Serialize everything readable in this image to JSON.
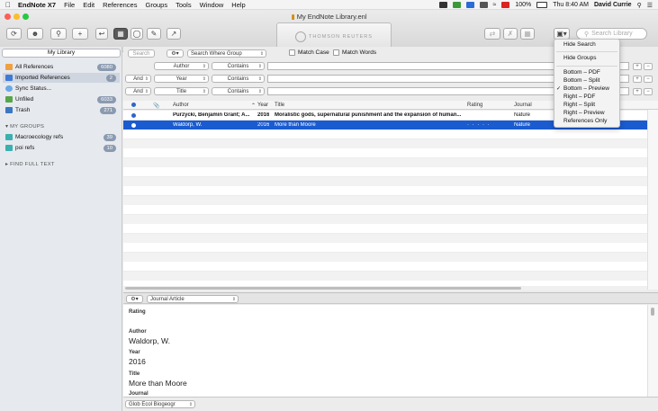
{
  "menubar": {
    "app": "EndNote X7",
    "items": [
      "File",
      "Edit",
      "References",
      "Groups",
      "Tools",
      "Window",
      "Help"
    ],
    "battery": "100%",
    "time": "Thu 8:40 AM",
    "user": "David Currie"
  },
  "window": {
    "title": "My EndNote Library.enl",
    "banner": "THOMSON REUTERS"
  },
  "search_library": {
    "placeholder": "Search Library"
  },
  "sidebar": {
    "library_select": "My Library",
    "items": [
      {
        "label": "All References",
        "count": "6080"
      },
      {
        "label": "Imported References",
        "count": "2"
      },
      {
        "label": "Sync Status...",
        "count": ""
      },
      {
        "label": "Unfiled",
        "count": "6033"
      },
      {
        "label": "Trash",
        "count": "271"
      }
    ],
    "groups_header": "MY GROUPS",
    "groups": [
      {
        "label": "Macroecology refs",
        "count": "39"
      },
      {
        "label": "poi refs",
        "count": "10"
      }
    ],
    "find_full_text": "FIND FULL TEXT"
  },
  "search_panel": {
    "search_button": "Search",
    "where": "Search Where Group",
    "match_case": "Match Case",
    "match_words": "Match Words",
    "rows": [
      {
        "bool": "",
        "field": "Author",
        "op": "Contains"
      },
      {
        "bool": "And",
        "field": "Year",
        "op": "Contains"
      },
      {
        "bool": "And",
        "field": "Title",
        "op": "Contains"
      }
    ]
  },
  "table": {
    "columns": [
      "Author",
      "Year",
      "Title",
      "Rating",
      "Journal"
    ],
    "rows": [
      {
        "author": "Purzycki, Benjamin Grant; A...",
        "year": "2016",
        "title": "Moralistic gods, supernatural punishment and the expansion of human...",
        "rating": "",
        "journal": "Nature"
      },
      {
        "author": "Waldorp, W.",
        "year": "2016",
        "title": "More than Moore",
        "rating": "· · · · ·",
        "journal": "Nature"
      }
    ]
  },
  "preview": {
    "ref_type": "Journal Article",
    "fields": [
      {
        "label": "Rating",
        "value": ""
      },
      {
        "label": "Author",
        "value": "Waldorp, W."
      },
      {
        "label": "Year",
        "value": "2016"
      },
      {
        "label": "Title",
        "value": "More than Moore"
      },
      {
        "label": "Journal",
        "value": ""
      }
    ],
    "style": "Glob Ecol Biogeogr"
  },
  "layout_menu": {
    "items": [
      "Hide Search",
      "Hide Groups",
      "Bottom – PDF",
      "Bottom – Split",
      "Bottom – Preview",
      "Right – PDF",
      "Right – Split",
      "Right – Preview",
      "References Only"
    ],
    "checked": "Bottom – Preview"
  }
}
